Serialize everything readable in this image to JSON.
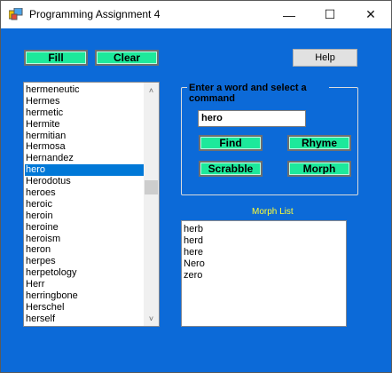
{
  "window": {
    "title": "Programming Assignment 4",
    "minimize_glyph": "—",
    "maximize_glyph": "☐",
    "close_glyph": "✕"
  },
  "toolbar": {
    "fill_label": "Fill",
    "clear_label": "Clear",
    "help_label": "Help"
  },
  "word_list": {
    "items": [
      "hermeneutic",
      "Hermes",
      "hermetic",
      "Hermite",
      "hermitian",
      "Hermosa",
      "Hernandez",
      "hero",
      "Herodotus",
      "heroes",
      "heroic",
      "heroin",
      "heroine",
      "heroism",
      "heron",
      "herpes",
      "herpetology",
      "Herr",
      "herringbone",
      "Herschel",
      "herself"
    ],
    "selected": "hero",
    "scroll_up_glyph": "˄",
    "scroll_down_glyph": "˅"
  },
  "command_group": {
    "title": "Enter a word and select a command",
    "input_value": "hero",
    "find_label": "Find",
    "rhyme_label": "Rhyme",
    "scrabble_label": "Scrabble",
    "morph_label": "Morph"
  },
  "morph": {
    "label": "Morph List",
    "items": [
      "herb",
      "herd",
      "here",
      "Nero",
      "zero"
    ]
  },
  "colors": {
    "form_background": "#0c6ad8",
    "button_green": "#1de99b",
    "selection": "#0078d7",
    "morph_label": "#ffff33"
  },
  "icons": {
    "app": "app-window-icon"
  }
}
